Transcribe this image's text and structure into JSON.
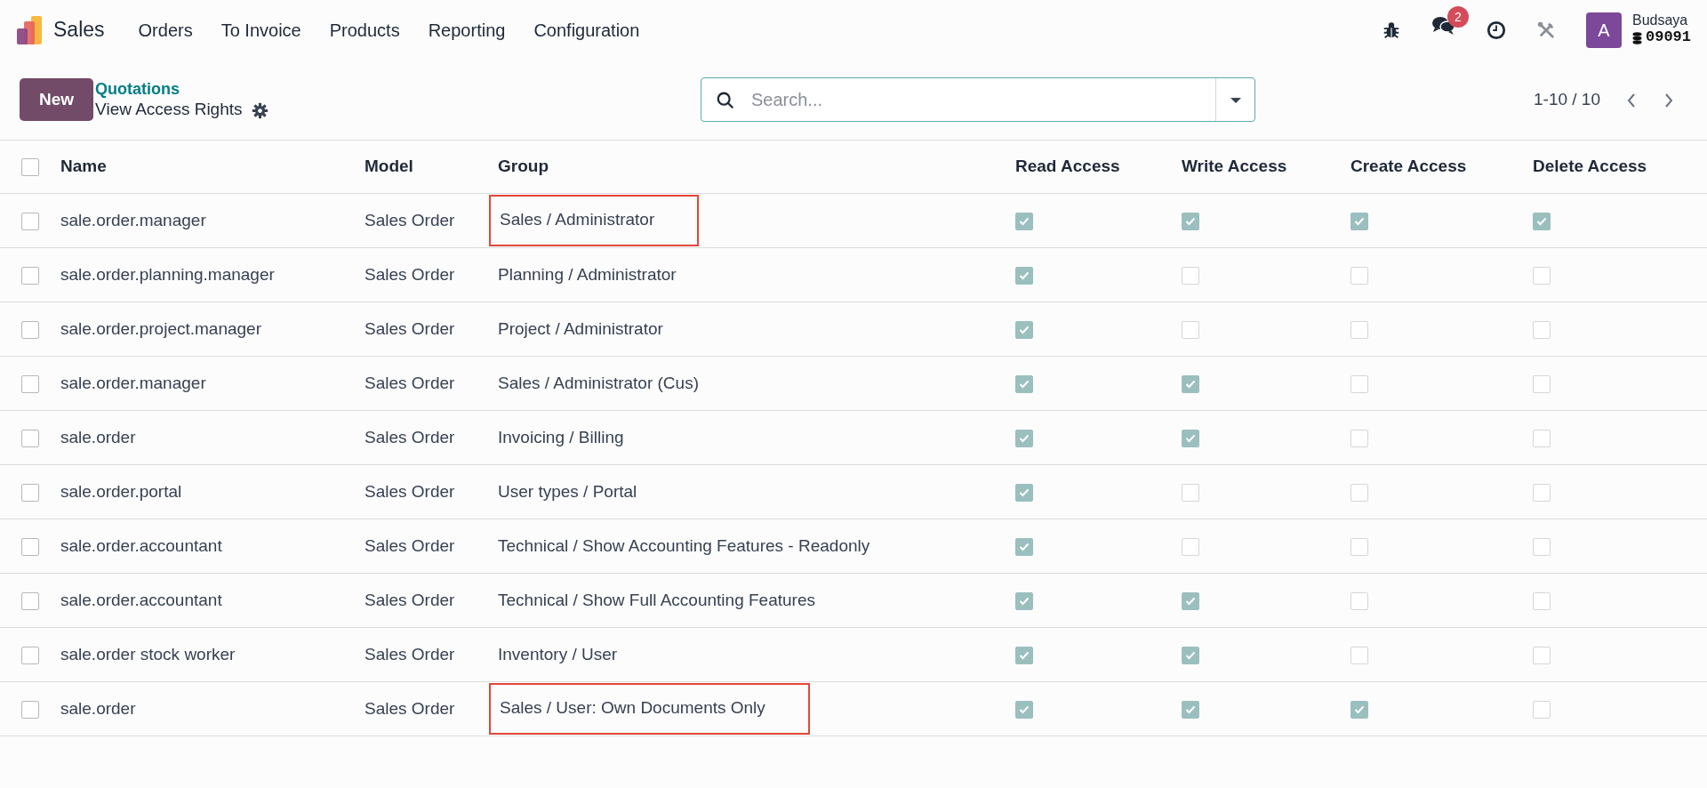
{
  "navbar": {
    "app": "Sales",
    "menu": [
      "Orders",
      "To Invoice",
      "Products",
      "Reporting",
      "Configuration"
    ],
    "messages_badge": "2",
    "avatar_letter": "A",
    "user": "Budsaya",
    "database": "09091"
  },
  "control_panel": {
    "new_button": "New",
    "breadcrumb": "Quotations",
    "title": "View Access Rights",
    "search": {
      "placeholder": "Search..."
    },
    "pager": "1-10 / 10"
  },
  "table": {
    "select_all_checked": false,
    "columns": [
      "Name",
      "Model",
      "Group",
      "Read Access",
      "Write Access",
      "Create Access",
      "Delete Access"
    ],
    "rows": [
      {
        "selected": false,
        "name": "sale.order.manager",
        "model": "Sales Order",
        "group": "Sales / Administrator",
        "highlighted": true,
        "read": true,
        "write": true,
        "create": true,
        "delete": true
      },
      {
        "selected": false,
        "name": "sale.order.planning.manager",
        "model": "Sales Order",
        "group": "Planning / Administrator",
        "highlighted": false,
        "read": true,
        "write": false,
        "create": false,
        "delete": false
      },
      {
        "selected": false,
        "name": "sale.order.project.manager",
        "model": "Sales Order",
        "group": "Project / Administrator",
        "highlighted": false,
        "read": true,
        "write": false,
        "create": false,
        "delete": false
      },
      {
        "selected": false,
        "name": "sale.order.manager",
        "model": "Sales Order",
        "group": "Sales / Administrator (Cus)",
        "highlighted": false,
        "read": true,
        "write": true,
        "create": false,
        "delete": false
      },
      {
        "selected": false,
        "name": "sale.order",
        "model": "Sales Order",
        "group": "Invoicing / Billing",
        "highlighted": false,
        "read": true,
        "write": true,
        "create": false,
        "delete": false
      },
      {
        "selected": false,
        "name": "sale.order.portal",
        "model": "Sales Order",
        "group": "User types / Portal",
        "highlighted": false,
        "read": true,
        "write": false,
        "create": false,
        "delete": false
      },
      {
        "selected": false,
        "name": "sale.order.accountant",
        "model": "Sales Order",
        "group": "Technical / Show Accounting Features - Readonly",
        "highlighted": false,
        "read": true,
        "write": false,
        "create": false,
        "delete": false
      },
      {
        "selected": false,
        "name": "sale.order.accountant",
        "model": "Sales Order",
        "group": "Technical / Show Full Accounting Features",
        "highlighted": false,
        "read": true,
        "write": true,
        "create": false,
        "delete": false
      },
      {
        "selected": false,
        "name": "sale.order stock worker",
        "model": "Sales Order",
        "group": "Inventory / User",
        "highlighted": false,
        "read": true,
        "write": true,
        "create": false,
        "delete": false
      },
      {
        "selected": false,
        "name": "sale.order",
        "model": "Sales Order",
        "group": "Sales / User: Own Documents Only",
        "highlighted": true,
        "read": true,
        "write": true,
        "create": true,
        "delete": false
      }
    ]
  }
}
